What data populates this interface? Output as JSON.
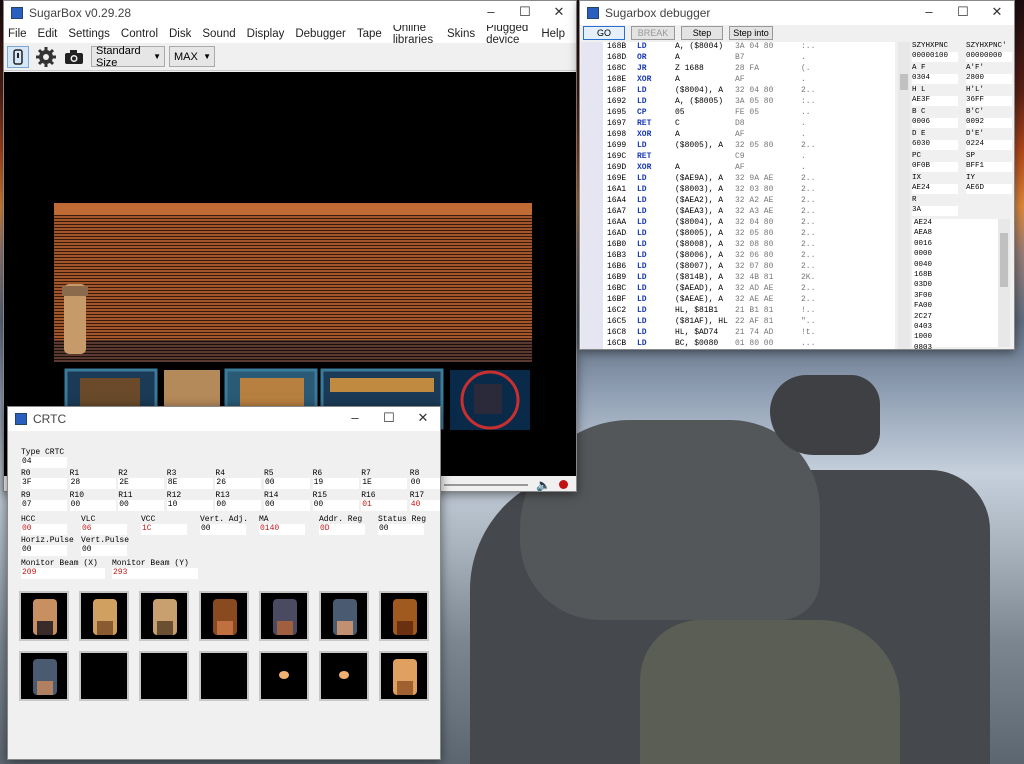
{
  "main": {
    "title": "SugarBox v0.29.28",
    "menu": [
      "File",
      "Edit",
      "Settings",
      "Control",
      "Disk",
      "Sound",
      "Display",
      "Debugger",
      "Tape",
      "Online libraries",
      "Skins",
      "Plugged device",
      "Help"
    ],
    "size_select": "Standard Size",
    "speed_select": "MAX"
  },
  "debugger": {
    "title": "Sugarbox debugger",
    "buttons": {
      "go": "GO",
      "break": "BREAK",
      "step": "Step",
      "step_into": "Step into"
    },
    "lines": [
      [
        "168B",
        "LD",
        "A, ($8004)",
        "3A 04 80",
        ":.."
      ],
      [
        "168D",
        "OR",
        "A",
        "B7",
        "."
      ],
      [
        "168C",
        "JR",
        "Z  1688",
        "28 FA",
        "(."
      ],
      [
        "168E",
        "XOR",
        "A",
        "AF",
        "."
      ],
      [
        "168F",
        "LD",
        "($8004), A",
        "32 04 80",
        "2.."
      ],
      [
        "1692",
        "LD",
        "A, ($8005)",
        "3A 05 80",
        ":.."
      ],
      [
        "1695",
        "CP",
        "05",
        "FE 05",
        ".."
      ],
      [
        "1697",
        "RET",
        "C",
        "D8",
        "."
      ],
      [
        "1698",
        "XOR",
        "A",
        "AF",
        "."
      ],
      [
        "1699",
        "LD",
        "($8005), A",
        "32 05 80",
        "2.."
      ],
      [
        "169C",
        "RET",
        "",
        "C9",
        "."
      ],
      [
        "169D",
        "XOR",
        "A",
        "AF",
        "."
      ],
      [
        "169E",
        "LD",
        "($AE9A), A",
        "32 9A AE",
        "2.."
      ],
      [
        "16A1",
        "LD",
        "($8003), A",
        "32 03 80",
        "2.."
      ],
      [
        "16A4",
        "LD",
        "($AEA2), A",
        "32 A2 AE",
        "2.."
      ],
      [
        "16A7",
        "LD",
        "($AEA3), A",
        "32 A3 AE",
        "2.."
      ],
      [
        "16AA",
        "LD",
        "($8004), A",
        "32 04 80",
        "2.."
      ],
      [
        "16AD",
        "LD",
        "($8005), A",
        "32 05 80",
        "2.."
      ],
      [
        "16B0",
        "LD",
        "($8008), A",
        "32 08 80",
        "2.."
      ],
      [
        "16B3",
        "LD",
        "($8006), A",
        "32 06 80",
        "2.."
      ],
      [
        "16B6",
        "LD",
        "($8007), A",
        "32 07 80",
        "2.."
      ],
      [
        "16B9",
        "LD",
        "($814B), A",
        "32 4B 81",
        "2K."
      ],
      [
        "16BC",
        "LD",
        "($AEAD), A",
        "32 AD AE",
        "2.."
      ],
      [
        "16BF",
        "LD",
        "($AEAE), A",
        "32 AE AE",
        "2.."
      ],
      [
        "16C2",
        "LD",
        "HL, $81B1",
        "21 B1 81",
        "!.."
      ],
      [
        "16C5",
        "LD",
        "($81AF), HL",
        "22 AF 81",
        "\".."
      ],
      [
        "16C8",
        "LD",
        "HL, $AD74",
        "21 74 AD",
        "!t."
      ],
      [
        "16CB",
        "LD",
        "BC, $0080",
        "01 80 00",
        "..."
      ]
    ],
    "registers": [
      [
        "SZYHXPNC",
        "00000100",
        "SZYHXPNC'",
        "00000000"
      ],
      [
        "A F",
        "0304",
        "A'F'",
        "2800"
      ],
      [
        "H L",
        "AE3F",
        "H'L'",
        "36FF"
      ],
      [
        "B C",
        "0006",
        "B'C'",
        "0092"
      ],
      [
        "D E",
        "6030",
        "D'E'",
        "0224"
      ],
      [
        "PC",
        "0F0B",
        "SP",
        "BFF1"
      ],
      [
        "IX",
        "AE24",
        "IY",
        "AE6D"
      ],
      [
        "R",
        "3A",
        "",
        ""
      ]
    ],
    "stack": [
      "AE24",
      "AEA8",
      "0016",
      "0000",
      "0040",
      "168B",
      "03D0",
      "3F00",
      "FA00",
      "2C27",
      "0403",
      "1000",
      "0803"
    ]
  },
  "crtc": {
    "title": "CRTC",
    "type_label": "Type CRTC",
    "type_value": "04",
    "regs_row1": [
      [
        "R0",
        "3F"
      ],
      [
        "R1",
        "28"
      ],
      [
        "R2",
        "2E"
      ],
      [
        "R3",
        "8E"
      ],
      [
        "R4",
        "26"
      ],
      [
        "R5",
        "00"
      ],
      [
        "R6",
        "19"
      ],
      [
        "R7",
        "1E"
      ],
      [
        "R8",
        "00"
      ]
    ],
    "regs_row2": [
      [
        "R9",
        "07"
      ],
      [
        "R10",
        "00"
      ],
      [
        "R11",
        "00"
      ],
      [
        "R12",
        "10"
      ],
      [
        "R13",
        "00"
      ],
      [
        "R14",
        "00"
      ],
      [
        "R15",
        "00"
      ],
      [
        "R16",
        "01"
      ],
      [
        "R17",
        "40"
      ]
    ],
    "counters": [
      [
        "HCC",
        "00"
      ],
      [
        "VLC",
        "06"
      ],
      [
        "VCC",
        "1C"
      ],
      [
        "Vert. Adj.",
        "00"
      ],
      [
        "MA",
        "0140"
      ],
      [
        "Addr. Reg",
        "0D"
      ],
      [
        "Status Reg",
        "00"
      ]
    ],
    "pulses": [
      [
        "Horiz.Pulse",
        "00"
      ],
      [
        "Vert.Pulse",
        "00"
      ]
    ],
    "beam": [
      [
        "Monitor Beam (X)",
        "209"
      ],
      [
        "Monitor Beam (Y)",
        "293"
      ]
    ]
  }
}
